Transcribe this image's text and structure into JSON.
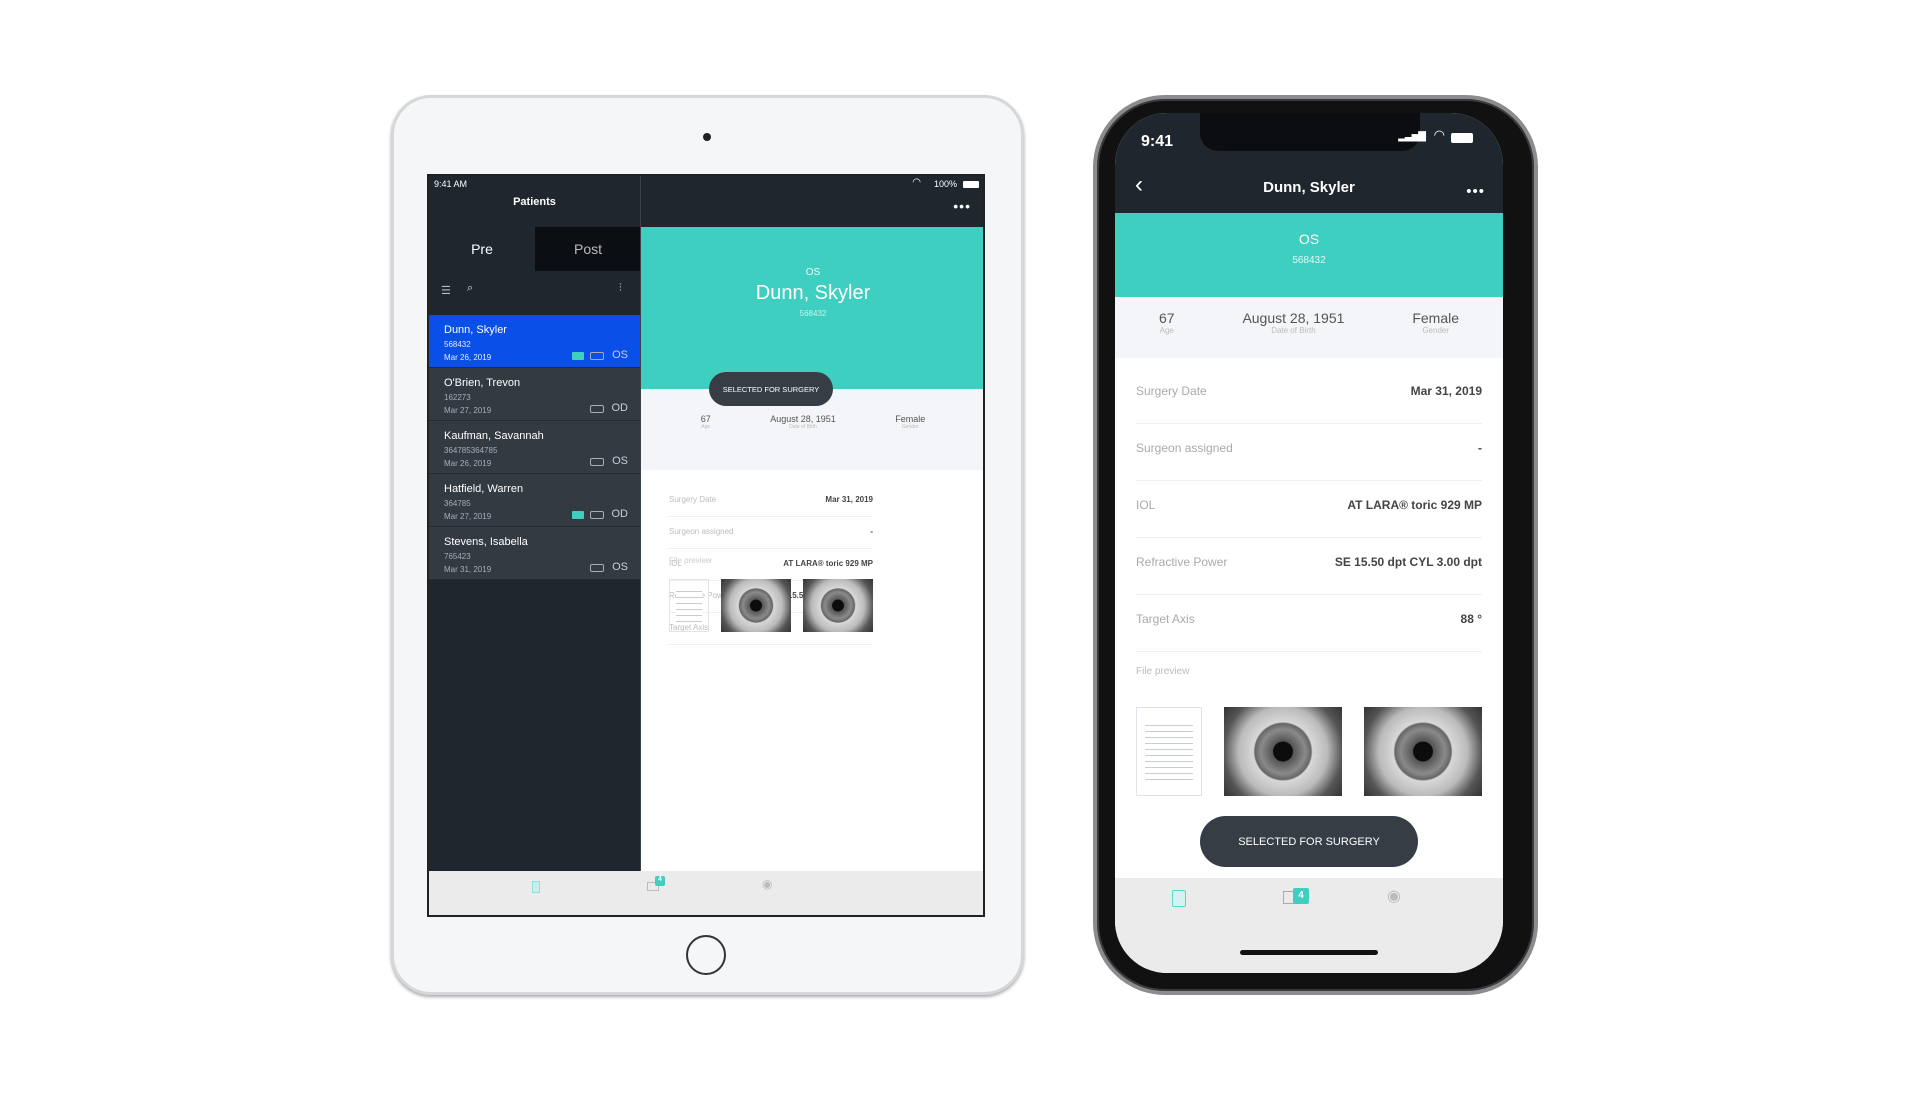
{
  "ipad": {
    "status": {
      "time": "9:41 AM",
      "battery": "100%"
    },
    "sidebar": {
      "title": "Patients",
      "tabs": [
        {
          "label": "Pre",
          "active": true
        },
        {
          "label": "Post",
          "active": false
        }
      ],
      "patients": [
        {
          "name": "Dunn, Skyler",
          "id": "568432",
          "date": "Mar 26, 2019",
          "eye": "OS",
          "monitor": true,
          "selected": true
        },
        {
          "name": "O'Brien, Trevon",
          "id": "162273",
          "date": "Mar 27, 2019",
          "eye": "OD",
          "monitor": false,
          "selected": false
        },
        {
          "name": "Kaufman, Savannah",
          "id": "364785364785",
          "date": "Mar 26, 2019",
          "eye": "OS",
          "monitor": false,
          "selected": false
        },
        {
          "name": "Hatfield, Warren",
          "id": "364785",
          "date": "Mar 27, 2019",
          "eye": "OD",
          "monitor": true,
          "selected": false
        },
        {
          "name": "Stevens, Isabella",
          "id": "765423",
          "date": "Mar 31, 2019",
          "eye": "OS",
          "monitor": false,
          "selected": false
        }
      ]
    },
    "detail": {
      "eye": "OS",
      "name": "Dunn, Skyler",
      "id": "568432",
      "button": "SELECTED FOR SURGERY"
    },
    "tabbar": {
      "badge": "4"
    }
  },
  "iphone": {
    "status": {
      "time": "9:41"
    },
    "nav": {
      "title": "Dunn, Skyler"
    },
    "header": {
      "eye": "OS",
      "id": "568432"
    },
    "button": "SELECTED FOR SURGERY",
    "tabbar": {
      "badge": "4"
    }
  },
  "patient": {
    "info": [
      {
        "value": "67",
        "label": "Age"
      },
      {
        "value": "August 28, 1951",
        "label": "Date of Birth"
      },
      {
        "value": "Female",
        "label": "Gender"
      }
    ],
    "fields": [
      {
        "label": "Surgery Date",
        "value": "Mar 31, 2019"
      },
      {
        "label": "Surgeon assigned",
        "value": "-"
      },
      {
        "label": "IOL",
        "value": "AT LARA® toric 929 MP"
      },
      {
        "label": "Refractive Power",
        "value": "SE 15.50 dpt CYL 3.00 dpt"
      },
      {
        "label": "Target Axis",
        "value": "88 °"
      }
    ],
    "file_preview_label": "File preview"
  },
  "colors": {
    "teal": "#3ecfc0",
    "selected_blue": "#0a4fe8",
    "dark": "#1f262e",
    "button": "#363d45"
  }
}
